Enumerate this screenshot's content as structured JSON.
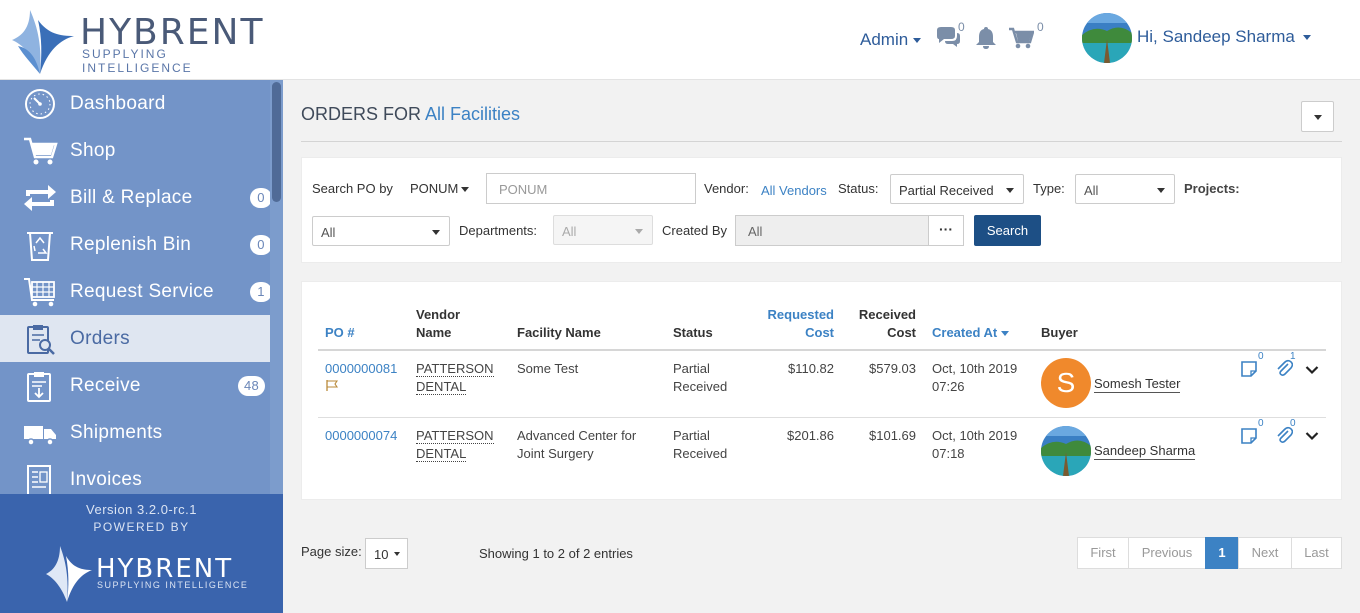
{
  "header": {
    "brand": "HYBRENT",
    "tagline": "SUPPLYING INTELLIGENCE",
    "admin_label": "Admin",
    "messages_count": "0",
    "cart_count": "0",
    "greeting": "Hi, Sandeep Sharma"
  },
  "sidebar": {
    "items": [
      {
        "label": "Dashboard",
        "icon": "dashboard-clock-icon",
        "badge": ""
      },
      {
        "label": "Shop",
        "icon": "cart-icon",
        "badge": ""
      },
      {
        "label": "Bill & Replace",
        "icon": "replace-arrows-icon",
        "badge": "0"
      },
      {
        "label": "Replenish Bin",
        "icon": "recycle-bin-icon",
        "badge": "0"
      },
      {
        "label": "Request Service",
        "icon": "service-cart-icon",
        "badge": "1"
      },
      {
        "label": "Orders",
        "icon": "clipboard-search-icon",
        "badge": ""
      },
      {
        "label": "Receive",
        "icon": "clipboard-receive-icon",
        "badge": "48"
      },
      {
        "label": "Shipments",
        "icon": "truck-icon",
        "badge": ""
      },
      {
        "label": "Invoices",
        "icon": "invoice-icon",
        "badge": ""
      }
    ],
    "version": "Version 3.2.0-rc.1",
    "powered_by": "POWERED BY",
    "footer_brand": "HYBRENT",
    "footer_tagline": "SUPPLYING INTELLIGENCE"
  },
  "page": {
    "title_prefix": "ORDERS FOR",
    "facility": "All Facilities"
  },
  "filters": {
    "search_po_label": "Search PO by",
    "search_po_type": "PONUM",
    "search_po_placeholder": "PONUM",
    "vendor_label": "Vendor:",
    "vendor_value": "All Vendors",
    "status_label": "Status:",
    "status_value": "Partial Received",
    "type_label": "Type:",
    "type_value": "All",
    "projects_label": "Projects:",
    "projects_value": "All",
    "departments_label": "Departments:",
    "departments_value": "All",
    "created_by_label": "Created By",
    "created_by_value": "All",
    "dots_label": "···",
    "search_button": "Search"
  },
  "table": {
    "headers": {
      "po": "PO #",
      "vendor_line1": "Vendor",
      "vendor_line2": "Name",
      "facility": "Facility Name",
      "status": "Status",
      "requested_line1": "Requested",
      "requested_line2": "Cost",
      "received_line1": "Received",
      "received_line2": "Cost",
      "created": "Created At",
      "buyer": "Buyer"
    },
    "rows": [
      {
        "po": "0000000081",
        "vendor_line1": "PATTERSON",
        "vendor_line2": "DENTAL",
        "facility_line1": "Some Test",
        "facility_line2": "",
        "status_line1": "Partial",
        "status_line2": "Received",
        "requested": "$110.82",
        "received": "$579.03",
        "created_line1": "Oct, 10th 2019",
        "created_line2": "07:26",
        "buyer_initial": "S",
        "buyer": "Somesh Tester",
        "notes_count": "0",
        "attachments_count": "1"
      },
      {
        "po": "0000000074",
        "vendor_line1": "PATTERSON",
        "vendor_line2": "DENTAL",
        "facility_line1": "Advanced Center for",
        "facility_line2": "Joint Surgery",
        "status_line1": "Partial",
        "status_line2": "Received",
        "requested": "$201.86",
        "received": "$101.69",
        "created_line1": "Oct, 10th 2019",
        "created_line2": "07:18",
        "buyer_initial": "",
        "buyer": "Sandeep Sharma",
        "notes_count": "0",
        "attachments_count": "0"
      }
    ]
  },
  "footer": {
    "page_size_label": "Page size:",
    "page_size": "10",
    "showing": "Showing 1 to 2 of 2 entries",
    "pager": {
      "first": "First",
      "previous": "Previous",
      "current": "1",
      "next": "Next",
      "last": "Last"
    }
  },
  "colors": {
    "accent": "#3c82c4",
    "sidebar": "#7394c8",
    "sidebar_footer": "#3a64ad",
    "primary_button": "#1d4f85",
    "buyer_avatar": "#f0892c"
  }
}
